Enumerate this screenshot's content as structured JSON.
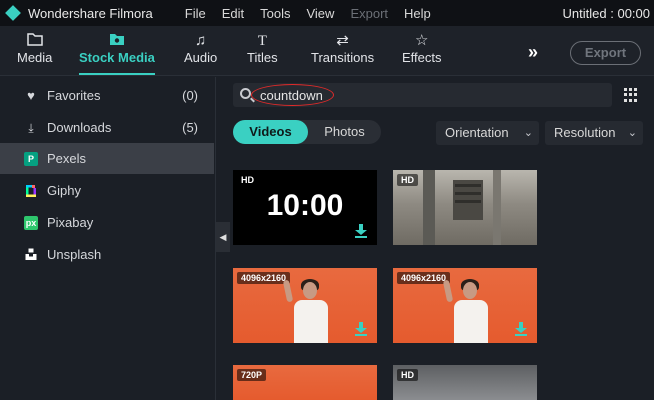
{
  "app": {
    "name": "Wondershare Filmora",
    "doc_title": "Untitled : 00:00"
  },
  "menu": [
    {
      "label": "File",
      "enabled": true
    },
    {
      "label": "Edit",
      "enabled": true
    },
    {
      "label": "Tools",
      "enabled": true
    },
    {
      "label": "View",
      "enabled": true
    },
    {
      "label": "Export",
      "enabled": false
    },
    {
      "label": "Help",
      "enabled": true
    }
  ],
  "toolbar": {
    "tabs": [
      {
        "label": "Media",
        "icon": "folder-icon"
      },
      {
        "label": "Stock Media",
        "icon": "stock-media-icon",
        "active": true
      },
      {
        "label": "Audio",
        "icon": "music-note-icon"
      },
      {
        "label": "Titles",
        "icon": "text-icon"
      },
      {
        "label": "Transitions",
        "icon": "transitions-icon"
      },
      {
        "label": "Effects",
        "icon": "effects-icon"
      }
    ],
    "more": "»",
    "export_label": "Export"
  },
  "sidebar": {
    "items": [
      {
        "label": "Favorites",
        "count": "(0)",
        "icon": "heart-icon"
      },
      {
        "label": "Downloads",
        "count": "(5)",
        "icon": "download-icon"
      },
      {
        "label": "Pexels",
        "icon": "pexels-icon",
        "active": true
      },
      {
        "label": "Giphy",
        "icon": "giphy-icon"
      },
      {
        "label": "Pixabay",
        "icon": "pixabay-icon"
      },
      {
        "label": "Unsplash",
        "icon": "unsplash-icon"
      }
    ],
    "pixabay_mark": "px",
    "pexels_mark": "P"
  },
  "search": {
    "value": "countdown"
  },
  "filters": {
    "type_tabs": [
      "Videos",
      "Photos"
    ],
    "orientation": "Orientation",
    "resolution": "Resolution"
  },
  "results": [
    {
      "badge": "HD",
      "overlay_text": "10:00",
      "style": "black",
      "download": true
    },
    {
      "badge": "HD",
      "style": "photo",
      "download": false
    },
    {
      "badge": "4096x2160",
      "style": "orange",
      "download": true
    },
    {
      "badge": "4096x2160",
      "style": "orange",
      "download": true
    },
    {
      "badge": "720P",
      "style": "orange",
      "download": false
    },
    {
      "badge": "HD",
      "style": "photo2",
      "download": false
    }
  ],
  "colors": {
    "accent": "#3ad0c2",
    "background": "#1b1f26",
    "highlight_circle": "#e02a2a"
  }
}
